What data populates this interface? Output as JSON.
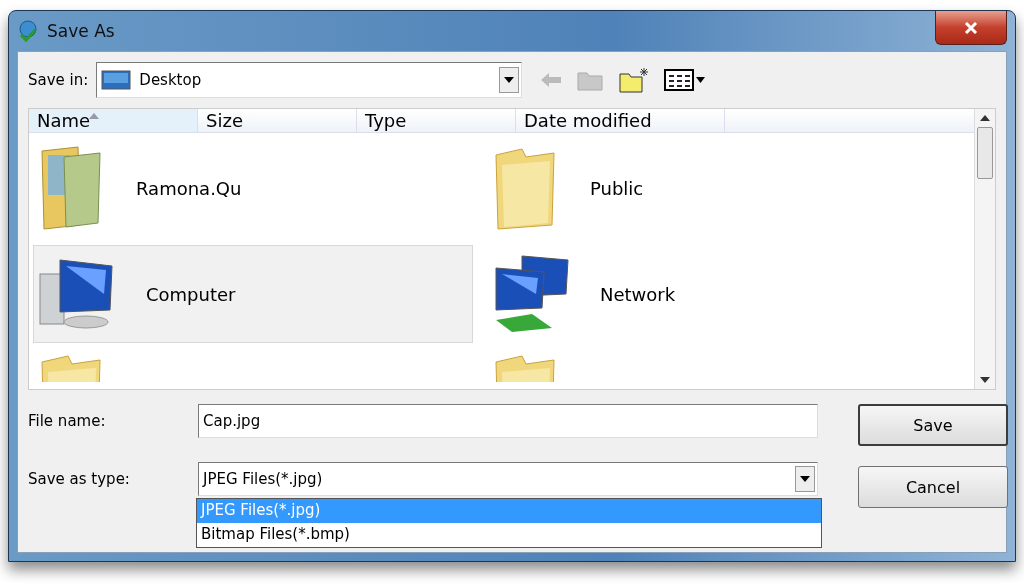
{
  "window": {
    "title": "Save As"
  },
  "save_in": {
    "label": "Save in:",
    "value": "Desktop"
  },
  "columns": [
    {
      "label": "Name",
      "sorted": true
    },
    {
      "label": "Size",
      "sorted": false
    },
    {
      "label": "Type",
      "sorted": false
    },
    {
      "label": "Date modified",
      "sorted": false
    }
  ],
  "items": [
    {
      "kind": "user-folder",
      "label": "Ramona.Qu",
      "selected": false
    },
    {
      "kind": "folder",
      "label": "Public",
      "selected": false
    },
    {
      "kind": "computer",
      "label": "Computer",
      "selected": true
    },
    {
      "kind": "network",
      "label": "Network",
      "selected": false
    },
    {
      "kind": "folder",
      "selected": false
    },
    {
      "kind": "folder",
      "selected": false
    }
  ],
  "file_name": {
    "label": "File name:",
    "value": "Cap.jpg"
  },
  "save_as_type": {
    "label": "Save as type:",
    "value": "JPEG Files(*.jpg)",
    "options": [
      {
        "label": "JPEG Files(*.jpg)",
        "selected": true
      },
      {
        "label": "Bitmap Files(*.bmp)",
        "selected": false
      }
    ]
  },
  "buttons": [
    {
      "label": "Save",
      "default": true
    },
    {
      "label": "Cancel",
      "default": false
    }
  ]
}
